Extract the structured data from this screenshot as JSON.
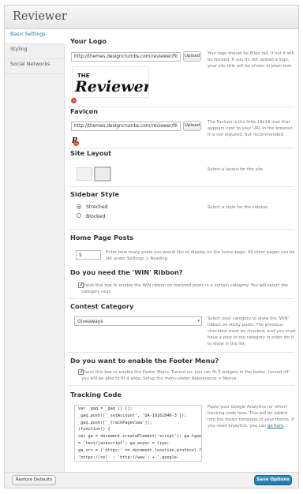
{
  "app": {
    "title": "Reviewer"
  },
  "sidebar": {
    "items": [
      {
        "label": "Basic Settings",
        "active": true
      },
      {
        "label": "Styling"
      },
      {
        "label": "Social Networks"
      }
    ]
  },
  "logo": {
    "title": "Your Logo",
    "url": "http://themes.designcrumbs.com/reviewer/fil",
    "upload_label": "Upload",
    "help": "Your logo should be 80px tall, if not it will be resized. If you do not upload a logo, your site title will be shown in plain text."
  },
  "favicon": {
    "title": "Favicon",
    "url": "http://themes.designcrumbs.com/reviewer/fil",
    "upload_label": "Upload",
    "help": "The Favicon is the little 16x16 icon that appears next to your URL in the browser. It is not required, but recommended."
  },
  "layout": {
    "title": "Site Layout",
    "help": "Select a layout for the site."
  },
  "sidebar_style": {
    "title": "Sidebar Style",
    "help": "Select a style for the sidebar.",
    "options": [
      {
        "label": "Streched",
        "checked": true
      },
      {
        "label": "Blocked",
        "checked": false
      }
    ]
  },
  "home_posts": {
    "title": "Home Page Posts",
    "value": "5",
    "help": "Enter how many posts you would like to display on the home page. All other pages can be set under Settings > Reading."
  },
  "win_ribbon": {
    "title": "Do you need the 'WIN' Ribbon?",
    "checked": true,
    "help": "Check this box to enable the WIN ribbon on featured posts in a certain category. You will select the category next."
  },
  "contest": {
    "title": "Contest Category",
    "selected": "Giveaways",
    "help": "Select your category to show the 'WIN' ribbon on sticky posts. The previous checkbox must be checked, and you must have a post in the category in order for it to show in the list."
  },
  "footer_menu": {
    "title": "Do you want to enable the Footer Menu?",
    "checked": true,
    "help": "Check this box to enable the Footer Menu. Turned on, you can fit 3 widgets in the footer, turned off you will be able to fit 4 wide. Setup the menu under Appearance > Menus"
  },
  "tracking": {
    "title": "Tracking Code",
    "help_text": "Paste your Google Analytics (or other) tracking code here. This will be added into the footer template of your theme. If you need analytics, you can ",
    "help_link": "go here",
    "help_end": ".",
    "lines": [
      "var _gaq = _gaq || [];",
      "_gaq.push(['_setAccount', 'UA-19161846-3']);",
      "_gaq.push(['_trackPageview']);",
      "",
      "(function() {",
      "  var ga = document.createElement('script'); ga.type",
      "= 'text/javascript'; ga.async = true;",
      "  ga.src = ('https:' == document.location.protocol ?",
      "'https://ssl' : 'http://www') + '.google-"
    ]
  },
  "footer": {
    "restore_label": "Restore Defaults",
    "save_label": "Save Options"
  },
  "colors": {
    "accent": "#21759b",
    "save_button": "#2a7fb3"
  }
}
